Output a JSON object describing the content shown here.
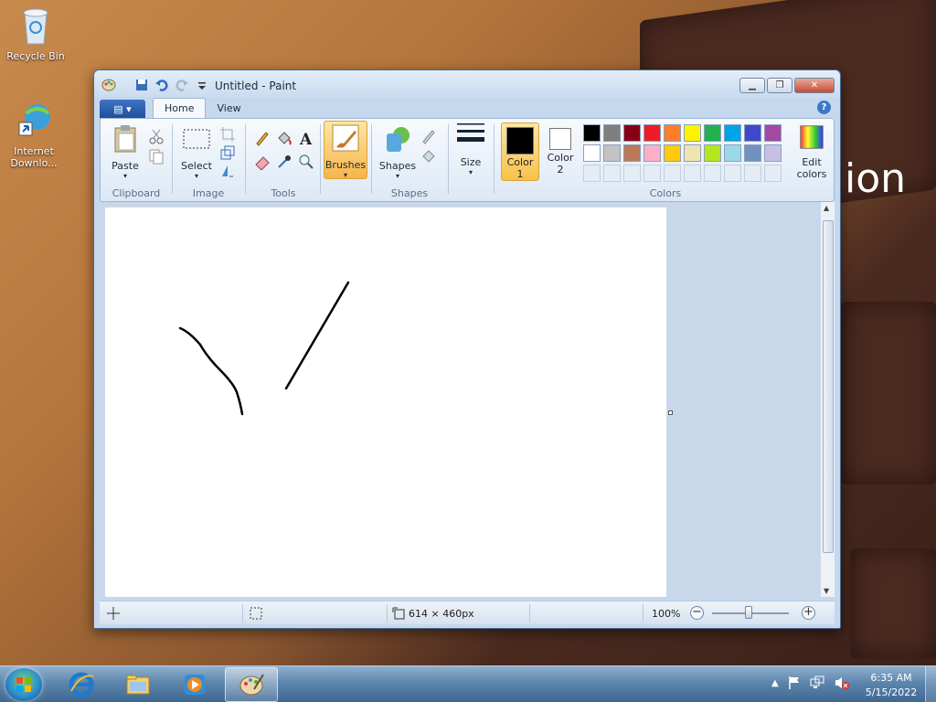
{
  "desktop": {
    "icons": [
      {
        "label": "Recycle Bin"
      },
      {
        "label": "Internet Downlo..."
      }
    ],
    "background_text": "ion"
  },
  "window": {
    "title": "Untitled - Paint",
    "tabs": [
      {
        "label": "Home",
        "active": true
      },
      {
        "label": "View",
        "active": false
      }
    ],
    "help": "?"
  },
  "ribbon": {
    "clipboard": {
      "paste": "Paste",
      "group": "Clipboard"
    },
    "image": {
      "select": "Select",
      "group": "Image"
    },
    "tools": {
      "group": "Tools"
    },
    "brushes": {
      "label": "Brushes"
    },
    "shapes": {
      "label": "Shapes",
      "group": "Shapes"
    },
    "size": {
      "label": "Size"
    },
    "color1": {
      "line1": "Color",
      "line2": "1",
      "value": "#000000"
    },
    "color2": {
      "line1": "Color",
      "line2": "2",
      "value": "#ffffff"
    },
    "edit_colors": {
      "line1": "Edit",
      "line2": "colors"
    },
    "colors_group": "Colors",
    "palette_row1": [
      "#000000",
      "#7f7f7f",
      "#880015",
      "#ed1c24",
      "#ff7f27",
      "#fff200",
      "#22b14c",
      "#00a2e8",
      "#3f48cc",
      "#a349a4"
    ],
    "palette_row2": [
      "#ffffff",
      "#c3c3c3",
      "#b97a57",
      "#ffaec9",
      "#ffc90e",
      "#efe4b0",
      "#b5e61d",
      "#99d9ea",
      "#7092be",
      "#c8bfe7"
    ]
  },
  "statusbar": {
    "dimensions": "614 × 460px",
    "zoom": "100%",
    "zoom_minus": "−",
    "zoom_plus": "+"
  },
  "taskbar": {
    "time": "6:35 AM",
    "date": "5/15/2022"
  }
}
